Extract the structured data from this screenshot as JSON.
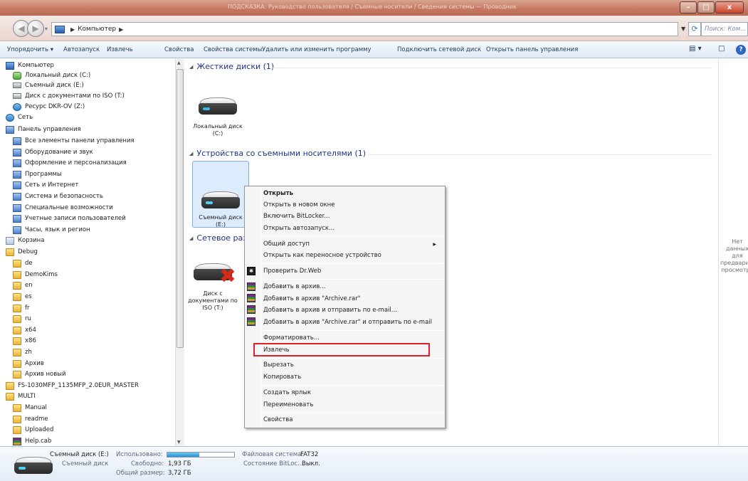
{
  "window": {
    "title": "ПОДСКАЗКА: Руководство пользователя / Съемные носители / Сведения системы — Проводник",
    "controls": {
      "minimize": "–",
      "maximize": "□",
      "close": "x"
    }
  },
  "address": {
    "segments": [
      "Компьютер"
    ],
    "search_placeholder": "Поиск: Ком..."
  },
  "toolbar": {
    "items": [
      "Упорядочить ▾",
      "Автозапуск",
      "Извлечь",
      "Свойства",
      "Свойства системы",
      "Удалить или изменить программу",
      "Подключить сетевой диск",
      "Открыть панель управления"
    ],
    "view_label": "▤ ▾"
  },
  "nav": {
    "items": [
      {
        "label": "Компьютер",
        "icon": "computer-icon"
      },
      {
        "label": "Локальный диск (C:)",
        "icon": "drive-icon"
      },
      {
        "label": "Съемный диск (E:)",
        "icon": "drive-icon"
      },
      {
        "label": "Диск с документами по ISO (T:)",
        "icon": "drive-icon"
      },
      {
        "label": "Ресурс DKR-OV (Z:)",
        "icon": "network-drive-icon"
      },
      {
        "label": "Сеть",
        "icon": "network-icon"
      },
      {
        "label": "Панель управления",
        "icon": "control-panel-icon"
      },
      {
        "label": "Все элементы панели управления",
        "icon": "control-panel-icon"
      },
      {
        "label": "Оборудование и звук",
        "icon": "control-panel-icon"
      },
      {
        "label": "Оформление и персонализация",
        "icon": "control-panel-icon"
      },
      {
        "label": "Программы",
        "icon": "control-panel-icon"
      },
      {
        "label": "Сеть и Интернет",
        "icon": "control-panel-icon"
      },
      {
        "label": "Система и безопасность",
        "icon": "control-panel-icon"
      },
      {
        "label": "Специальные возможности",
        "icon": "control-panel-icon"
      },
      {
        "label": "Учетные записи пользователей",
        "icon": "control-panel-icon"
      },
      {
        "label": "Часы, язык и регион",
        "icon": "control-panel-icon"
      },
      {
        "label": "Корзина",
        "icon": "recycle-bin-icon"
      },
      {
        "label": "Debug",
        "icon": "folder-icon"
      },
      {
        "label": "de",
        "icon": "folder-icon"
      },
      {
        "label": "DemoKims",
        "icon": "folder-icon"
      },
      {
        "label": "en",
        "icon": "folder-icon"
      },
      {
        "label": "es",
        "icon": "folder-icon"
      },
      {
        "label": "fr",
        "icon": "folder-icon"
      },
      {
        "label": "ru",
        "icon": "folder-icon"
      },
      {
        "label": "x64",
        "icon": "folder-icon"
      },
      {
        "label": "x86",
        "icon": "folder-icon"
      },
      {
        "label": "zh",
        "icon": "folder-icon"
      },
      {
        "label": "Архив",
        "icon": "folder-icon"
      },
      {
        "label": "Архив новый",
        "icon": "folder-icon"
      },
      {
        "label": "FS-1030MFP_1135MFP_2.0EUR_MASTER",
        "icon": "folder-icon"
      },
      {
        "label": "MULTI",
        "icon": "folder-icon"
      },
      {
        "label": "Manual",
        "icon": "folder-icon"
      },
      {
        "label": "readme",
        "icon": "folder-icon"
      },
      {
        "label": "Uploaded",
        "icon": "folder-icon"
      },
      {
        "label": "Help.cab",
        "icon": "archive-icon"
      }
    ]
  },
  "main": {
    "groups": [
      {
        "title": "Жесткие диски (1)"
      },
      {
        "title": "Устройства со съемными носителями (1)"
      },
      {
        "title": "Сетевое разм"
      }
    ],
    "tiles": [
      {
        "line1": "Локальный диск",
        "line2": "(C:)"
      },
      {
        "line1": "Съемный диск",
        "line2": "(E:)"
      },
      {
        "line1": "Диск с",
        "line2": "документами по",
        "line3": "ISO (T:)"
      }
    ]
  },
  "preview": {
    "text": "Нет данных для предварительного просмотра"
  },
  "context_menu": {
    "items": [
      "Открыть",
      "Открыть в новом окне",
      "Включить BitLocker...",
      "Открыть автозапуск...",
      "Общий доступ",
      "Открыть как переносное устройство",
      "Проверить Dr.Web",
      "Добавить в архив...",
      "Добавить в архив \"Archive.rar\"",
      "Добавить в архив и отправить по e-mail...",
      "Добавить в архив \"Archive.rar\" и отправить по e-mail",
      "Форматировать...",
      "Извлечь",
      "Вырезать",
      "Копировать",
      "Создать ярлык",
      "Переименовать",
      "Свойства"
    ],
    "highlighted": "Извлечь",
    "highlight_color": "#e3202a"
  },
  "details": {
    "name": "Съемный диск (E:)",
    "type": "Съемный диск",
    "used_label": "Использовано:",
    "used_fraction": 0.48,
    "free_label": "Свободно:",
    "free_value": "1,93 ГБ",
    "total_label": "Общий размер:",
    "total_value": "3,72 ГБ",
    "fs_label": "Файловая система:",
    "fs_value": "FAT32",
    "bitlocker_label": "Состояние BitLoc...",
    "bitlocker_value": "Выкл."
  }
}
